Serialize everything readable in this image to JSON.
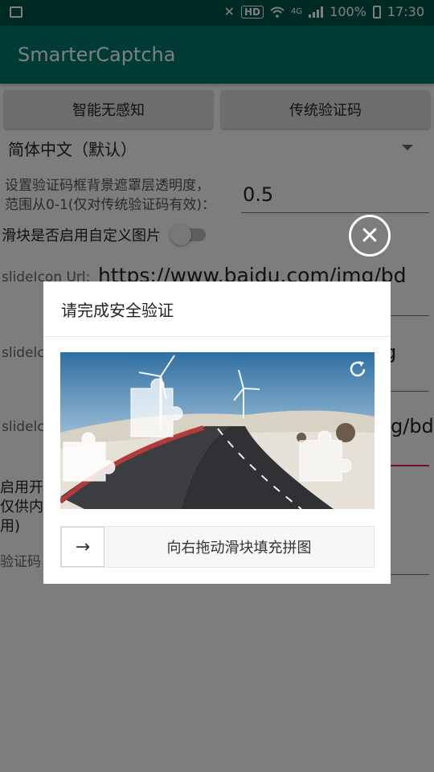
{
  "status_bar": {
    "hd": "HD",
    "network": "4G",
    "battery": "100%",
    "time": "17:30"
  },
  "app_bar": {
    "title": "SmarterCaptcha"
  },
  "buttons": {
    "smart": "智能无感知",
    "traditional": "传统验证码"
  },
  "language_spinner": {
    "selected": "简体中文（默认）"
  },
  "opacity_setting": {
    "label_line1": "设置验证码框背景遮罩层透明度，",
    "label_line2": "范围从0-1(仅对传统验证码有效)：",
    "value": "0.5"
  },
  "custom_image_switch": {
    "label": "滑块是否启用自定义图片"
  },
  "slide_icon_url": {
    "label": "slideIcon Url:",
    "value": "https://www.baidu.com/img/bd"
  },
  "row2": {
    "label_partial": "slidelc",
    "value_partial": "g"
  },
  "row3": {
    "label_partial": "slidelc",
    "value_partial": "g/bd"
  },
  "dev_mode": {
    "line1": "启用开",
    "line2": "仅供内",
    "line3": "用)"
  },
  "captcha_row": {
    "label_partial": "验证码"
  },
  "dialog": {
    "title": "请完成安全验证",
    "slider_hint": "向右拖动滑块填充拼图",
    "knob_arrow": "→",
    "close_symbol": "✕"
  },
  "colors": {
    "status_bar": "#00574b",
    "app_bar": "#00796b",
    "accent": "#e91e63"
  },
  "icons": [
    "image-icon",
    "mute-icon",
    "wifi-icon",
    "signal-icon",
    "battery-icon",
    "dropdown-arrow-icon",
    "close-icon",
    "refresh-icon",
    "arrow-right-icon"
  ]
}
